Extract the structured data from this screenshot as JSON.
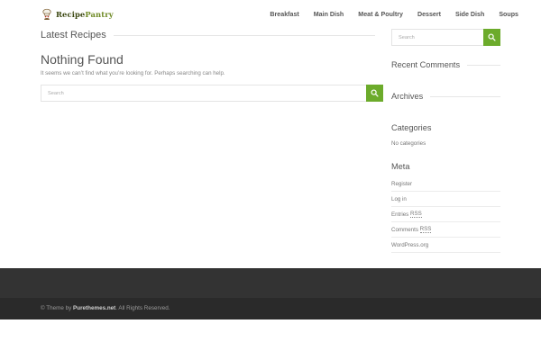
{
  "header": {
    "logo_text_1": "Recipe",
    "logo_text_2": "Pantry",
    "nav": [
      "Breakfast",
      "Main Dish",
      "Meat & Poultry",
      "Dessert",
      "Side Dish",
      "Soups"
    ]
  },
  "main": {
    "section_title": "Latest Recipes",
    "heading": "Nothing Found",
    "message": "It seems we can’t find what you’re looking for. Perhaps searching can help.",
    "search_placeholder": "Search"
  },
  "sidebar": {
    "search_placeholder": "Search",
    "recent_comments_title": "Recent Comments",
    "archives_title": "Archives",
    "categories_title": "Categories",
    "categories_text": "No categories",
    "meta_title": "Meta",
    "meta_items": [
      {
        "pre": "Register",
        "abbr": "",
        "post": ""
      },
      {
        "pre": "Log in",
        "abbr": "",
        "post": ""
      },
      {
        "pre": "Entries ",
        "abbr": "RSS",
        "post": ""
      },
      {
        "pre": "Comments ",
        "abbr": "RSS",
        "post": ""
      },
      {
        "pre": "WordPress.org",
        "abbr": "",
        "post": ""
      }
    ]
  },
  "footer": {
    "prefix": "© Theme by ",
    "link": "Purethemes.net",
    "suffix": ". All Rights Reserved."
  },
  "colors": {
    "accent_green": "#6cab2b",
    "footer_dark": "#333333",
    "footer_darker": "#2a2a2a"
  },
  "icons": {
    "search_button": "search-icon",
    "logo": "chef-hat-logo-icon"
  }
}
